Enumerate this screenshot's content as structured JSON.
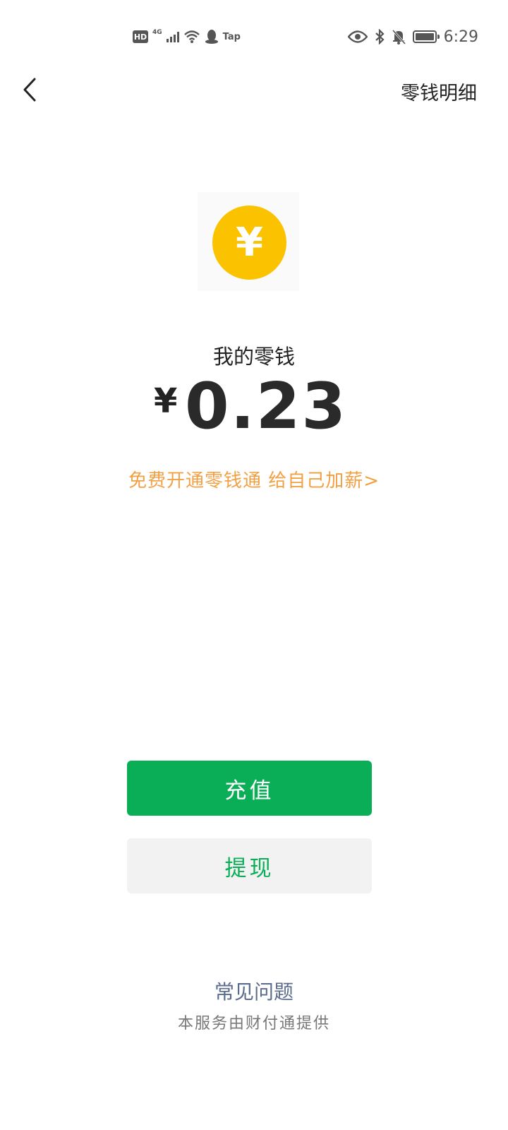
{
  "status_bar": {
    "left_icons": [
      "hd-badge",
      "4g-signal",
      "wifi",
      "qq-penguin",
      "tap"
    ],
    "hd_label": "HD",
    "network_label": "4G",
    "tap_label": "Tap",
    "right_icons": [
      "eye-icon",
      "bluetooth-icon",
      "mute-bell-icon",
      "battery-icon"
    ],
    "time": "6:29"
  },
  "nav": {
    "back_icon": "chevron-left-icon",
    "detail_label": "零钱明细"
  },
  "wallet": {
    "coin_symbol": "¥",
    "label": "我的零钱",
    "currency": "¥",
    "amount": "0.23",
    "coin_color": "#fbc200"
  },
  "promo": {
    "text": "免费开通零钱通 给自己加薪>",
    "color": "#f2a044"
  },
  "actions": {
    "recharge_label": "充值",
    "withdraw_label": "提现",
    "accent_color": "#0aae57"
  },
  "footer": {
    "faq_label": "常见问题",
    "provider_text": "本服务由财付通提供"
  }
}
